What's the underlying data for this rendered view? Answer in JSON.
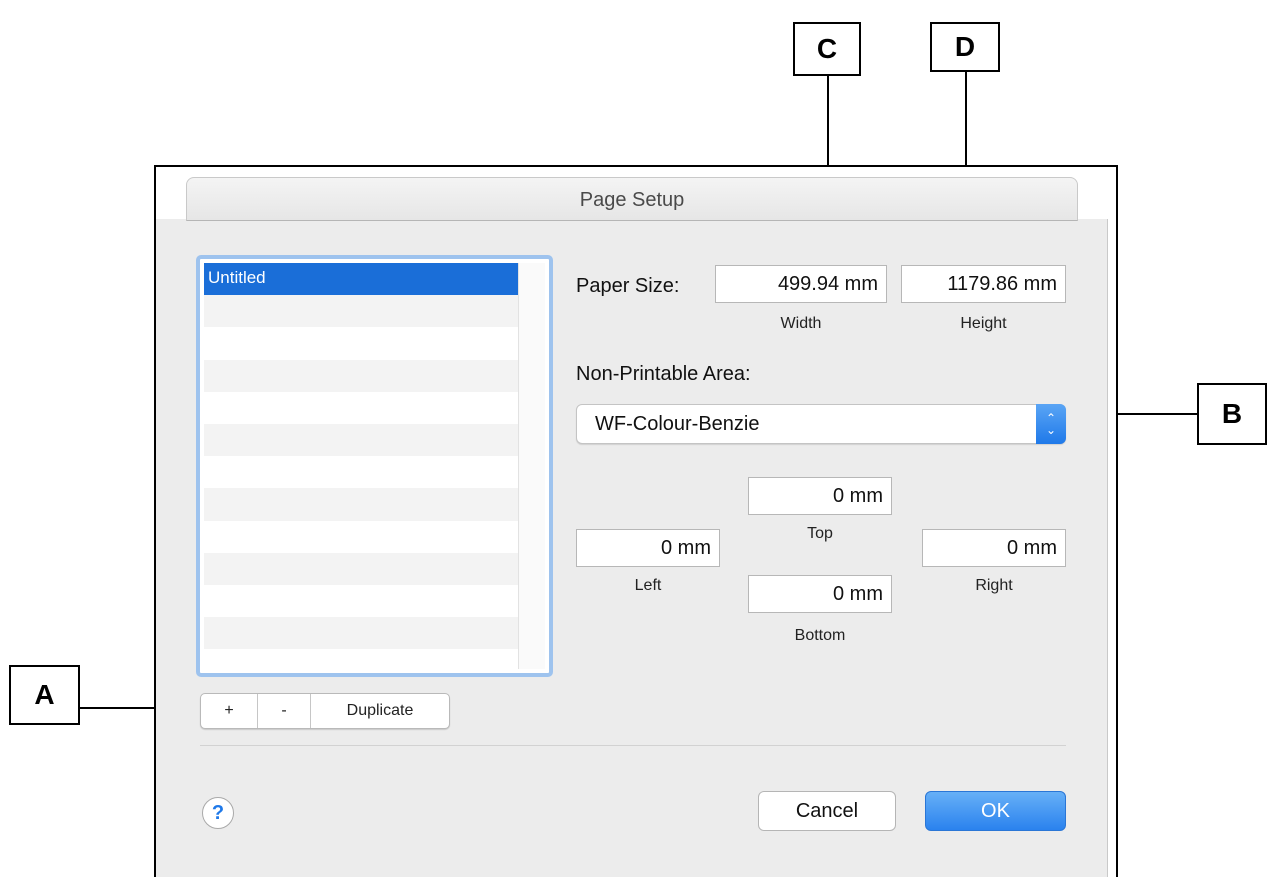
{
  "callouts": {
    "a": "A",
    "b": "B",
    "c": "C",
    "d": "D"
  },
  "dialog": {
    "title": "Page Setup",
    "list": {
      "items": [
        "Untitled",
        "",
        "",
        "",
        "",
        "",
        "",
        "",
        "",
        "",
        "",
        "",
        ""
      ],
      "selected": "Untitled"
    },
    "list_buttons": {
      "add": "+",
      "remove": "-",
      "duplicate": "Duplicate"
    },
    "paper_size": {
      "label": "Paper Size:",
      "width_value": "499.94 mm",
      "width_label": "Width",
      "height_value": "1179.86 mm",
      "height_label": "Height"
    },
    "non_printable": {
      "label": "Non-Printable Area:",
      "selected": "WF-Colour-Benzie",
      "top_value": "0 mm",
      "top_label": "Top",
      "left_value": "0 mm",
      "left_label": "Left",
      "right_value": "0 mm",
      "right_label": "Right",
      "bottom_value": "0 mm",
      "bottom_label": "Bottom"
    },
    "help": "?",
    "cancel": "Cancel",
    "ok": "OK"
  },
  "colors": {
    "accent": "#1a6ed8",
    "selection": "#1a6ed8",
    "focus_ring": "#9ec3ee"
  },
  "icons": {
    "help": "question-mark-icon",
    "select": "chevron-up-down-icon"
  }
}
